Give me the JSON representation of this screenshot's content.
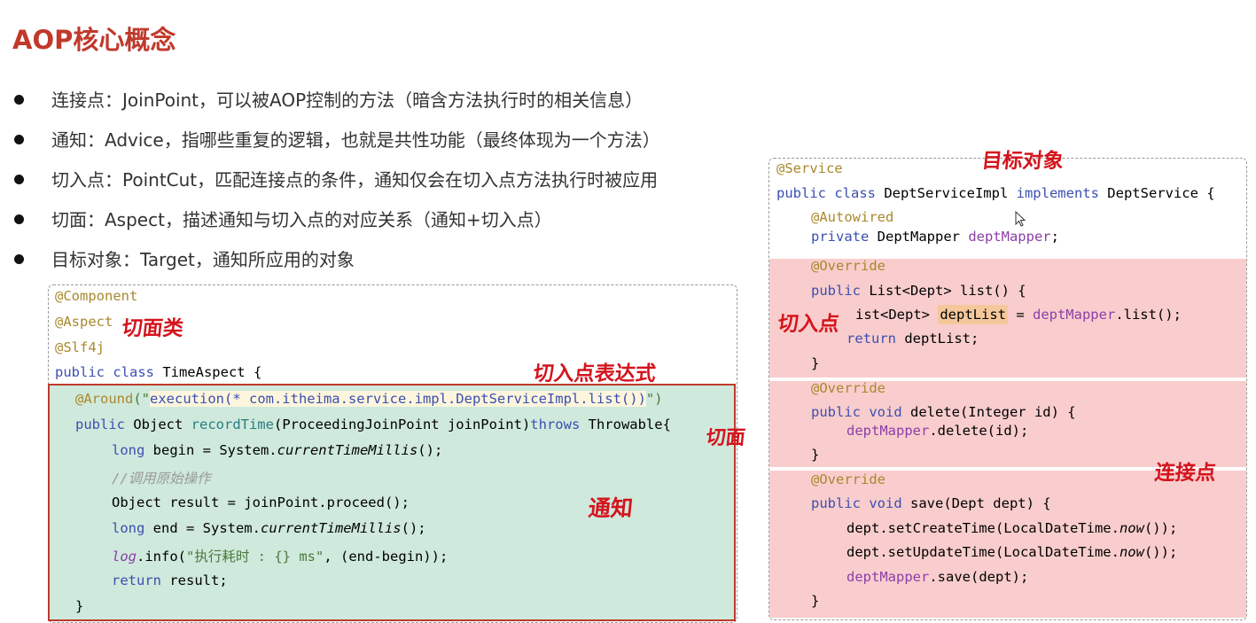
{
  "title": "AOP核心概念",
  "bullets": [
    "连接点：JoinPoint，可以被AOP控制的方法（暗含方法执行时的相关信息）",
    "通知：Advice，指哪些重复的逻辑，也就是共性功能（最终体现为一个方法）",
    "切入点：PointCut，匹配连接点的条件，通知仅会在切入点方法执行时被应用",
    "切面：Aspect，描述通知与切入点的对应关系（通知+切入点）",
    "目标对象：Target，通知所应用的对象"
  ],
  "left_code": {
    "l1": "@Component",
    "l2": "@Aspect",
    "l3": "@Slf4j",
    "l4_kw": "public class",
    "l4_name": " TimeAspect {",
    "l5_ann": "@Around",
    "l5_open": "(\"",
    "l5_expr": "execution(* com.itheima.service.impl.DeptServiceImpl.list())",
    "l5_close": "\")",
    "l6_kw": "public",
    "l6_type": " Object ",
    "l6_fn": "recordTime",
    "l6_params": "(ProceedingJoinPoint joinPoint)",
    "l6_throws": "throws",
    "l6_exc": " Throwable{",
    "l7_kw": "long",
    "l7_mid": " begin = System.",
    "l7_it": "currentTimeMillis",
    "l7_end": "();",
    "l8": "//调用原始操作",
    "l9": "Object result = joinPoint.proceed();",
    "l10_kw": "long",
    "l10_mid": " end = System.",
    "l10_it": "currentTimeMillis",
    "l10_end": "();",
    "l11_it": "log",
    "l11_mid": ".info(",
    "l11_str": "\"执行耗时 : {} ms\"",
    "l11_end": ", (end-begin));",
    "l12_kw": "return",
    "l12_rest": " result;",
    "l13": "}"
  },
  "right_code": {
    "r1": "@Service",
    "r2_kw": "public class",
    "r2_name": " DeptServiceImpl ",
    "r2_impl": "implements",
    "r2_iface": " DeptService {",
    "r3": "@Autowired",
    "r4_kw": "private",
    "r4_type": " DeptMapper ",
    "r4_fld": "deptMapper",
    "r4_end": ";",
    "r5": "@Override",
    "r6_kw": "public",
    "r6_rest": " List<Dept> list() {",
    "r7_pre": "ist<Dept> ",
    "r7_var": "deptList",
    "r7_eq": " = ",
    "r7_fld": "deptMapper",
    "r7_end": ".list();",
    "r8_kw": "return",
    "r8_rest": " deptList;",
    "r9": "}",
    "r10": "@Override",
    "r11_kw": "public void",
    "r11_rest": " delete(Integer id) {",
    "r12_fld": "deptMapper",
    "r12_end": ".delete(id);",
    "r13": "}",
    "r14": "@Override",
    "r15_kw": "public void",
    "r15_rest": " save(Dept dept) {",
    "r16_pre": "dept.setCreateTime(LocalDateTime.",
    "r16_it": "now",
    "r16_end": "());",
    "r17_pre": "dept.setUpdateTime(LocalDateTime.",
    "r17_it": "now",
    "r17_end": "());",
    "r18_fld": "deptMapper",
    "r18_end": ".save(dept);",
    "r19": "}"
  },
  "annotations": {
    "aspect_class": "切面类",
    "pointcut_expr": "切入点表达式",
    "aspect": "切面",
    "advice": "通知",
    "target": "目标对象",
    "pointcut": "切入点",
    "joinpoint": "连接点"
  },
  "colors": {
    "title": "#c0392b",
    "handwriting": "#d4141d",
    "advice_bg": "#cfe9dc",
    "joinpoint_bg": "#f9cdcd"
  }
}
